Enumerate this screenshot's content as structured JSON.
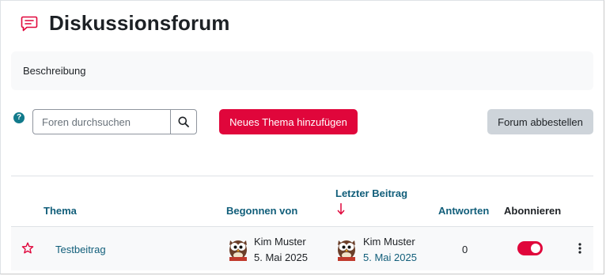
{
  "page": {
    "title": "Diskussionsforum",
    "title_icon": "forum-speech-bubble-icon",
    "accent_color": "#e0063b",
    "link_color": "#115e7a"
  },
  "description": "Beschreibung",
  "toolbar": {
    "help_icon": "question-circle-icon",
    "search_placeholder": "Foren durchsuchen",
    "search_icon": "search-icon",
    "add_topic_label": "Neues Thema hinzufügen",
    "unsubscribe_label": "Forum abbestellen"
  },
  "table": {
    "headers": {
      "topic": "Thema",
      "started_by": "Begonnen von",
      "last_post": "Letzter Beitrag",
      "replies": "Antworten",
      "subscribe": "Abonnieren"
    },
    "sort_icon": "arrow-down-icon",
    "rows": [
      {
        "star_icon": "star-outline-icon",
        "topic": "Testbeitrag",
        "started_by_name": "Kim Muster",
        "started_by_date": "5. Mai 2025",
        "last_post_name": "Kim Muster",
        "last_post_date": "5. Mai 2025",
        "replies": "0",
        "subscribed": true,
        "menu_icon": "kebab-menu-icon"
      }
    ]
  }
}
